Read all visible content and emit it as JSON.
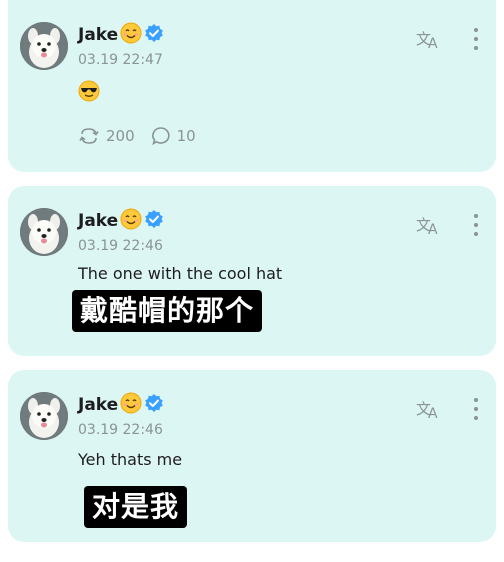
{
  "posts": [
    {
      "username": "Jake",
      "timestamp": "03.19 22:47",
      "content_emoji": "sunglasses-emoji",
      "repost_count": "200",
      "comment_count": "10"
    },
    {
      "username": "Jake",
      "timestamp": "03.19 22:46",
      "text": "The one with the cool hat",
      "subtitle": "戴酷帽的那个"
    },
    {
      "username": "Jake",
      "timestamp": "03.19 22:46",
      "text": "Yeh thats me",
      "subtitle": "对是我"
    }
  ],
  "icons": {
    "name_emoji": "smiling-face-emoji",
    "verified": "verified-badge-icon",
    "translate": "translate-icon",
    "more": "more-vertical-icon",
    "repost": "repost-icon",
    "comment": "comment-icon"
  },
  "colors": {
    "card_background": "#dcf6f3",
    "verified_blue": "#3aa0ff",
    "muted_text": "#8a9396",
    "subtitle_background": "#000000"
  }
}
